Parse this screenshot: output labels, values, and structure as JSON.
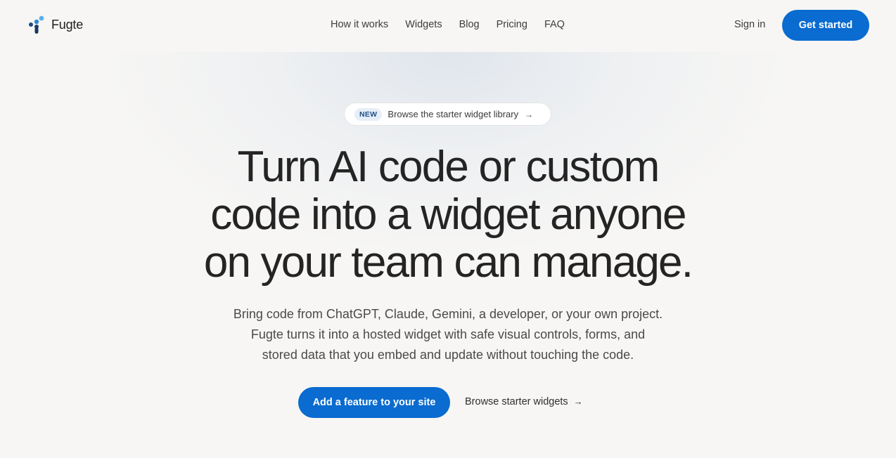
{
  "brand": {
    "name": "Fugte",
    "accent": "#0a6bd0"
  },
  "nav": {
    "items": [
      {
        "label": "How it works"
      },
      {
        "label": "Widgets"
      },
      {
        "label": "Blog"
      },
      {
        "label": "Pricing"
      },
      {
        "label": "FAQ"
      }
    ],
    "sign_in": "Sign in",
    "get_started": "Get started"
  },
  "hero": {
    "badge": {
      "tag": "NEW",
      "text": "Browse the starter widget library",
      "arrow": "→"
    },
    "title_lines": [
      "Turn AI code or custom",
      "code into a widget anyone",
      "on your team can manage."
    ],
    "subtitle_lines": [
      "Bring code from ChatGPT, Claude, Gemini, a developer, or your own project.",
      "Fugte turns it into a hosted widget with safe visual controls, forms, and",
      "stored data that you embed and update without touching the code."
    ],
    "primary_cta": "Add a feature to your site",
    "secondary_cta": "Browse starter widgets",
    "secondary_arrow": "→"
  }
}
